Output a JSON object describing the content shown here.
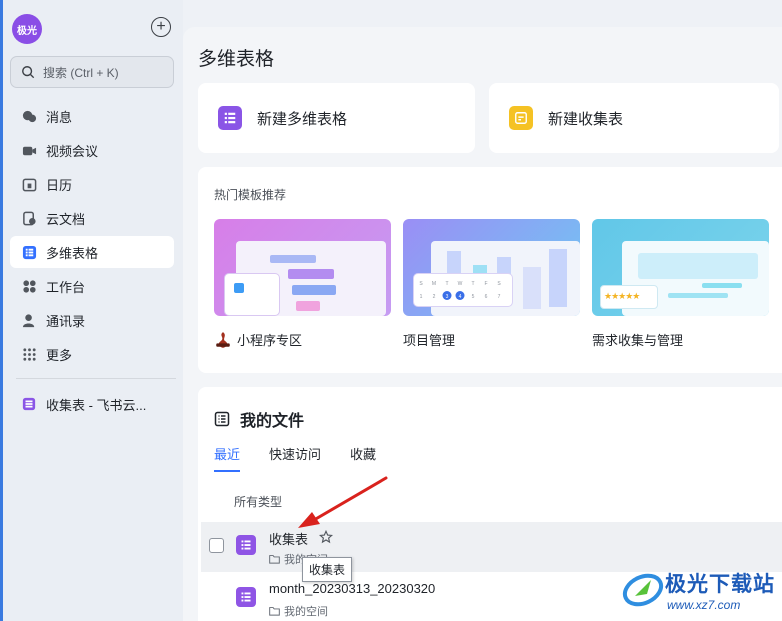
{
  "sidebar": {
    "avatar_text": "极光",
    "add_symbol": "+",
    "search_placeholder": "搜索 (Ctrl + K)",
    "items": [
      {
        "label": "消息",
        "icon": "chat-bubble-icon"
      },
      {
        "label": "视频会议",
        "icon": "video-camera-icon"
      },
      {
        "label": "日历",
        "icon": "calendar-icon"
      },
      {
        "label": "云文档",
        "icon": "cloud-doc-icon"
      },
      {
        "label": "多维表格",
        "icon": "base-table-icon",
        "active": true
      },
      {
        "label": "工作台",
        "icon": "workplace-grid-icon"
      },
      {
        "label": "通讯录",
        "icon": "contacts-icon"
      },
      {
        "label": "更多",
        "icon": "more-dots-icon"
      }
    ],
    "recent_doc": "收集表 - 飞书云..."
  },
  "main": {
    "title": "多维表格",
    "create": [
      {
        "label": "新建多维表格",
        "icon": "base-table-icon",
        "color": "#8a55e6"
      },
      {
        "label": "新建收集表",
        "icon": "form-icon",
        "color": "#f5c224"
      }
    ],
    "templates": {
      "heading": "热门模板推荐",
      "items": [
        {
          "label": "小程序专区",
          "icon": "miniapp-icon"
        },
        {
          "label": "项目管理"
        },
        {
          "label": "需求收集与管理"
        }
      ],
      "calendar_glyphs": [
        "S",
        "M",
        "T",
        "W",
        "T",
        "F",
        "S",
        "1",
        "2",
        "3",
        "4",
        "5",
        "6",
        "7"
      ]
    },
    "files": {
      "title": "我的文件",
      "tabs": [
        "最近",
        "快速访问",
        "收藏"
      ],
      "active_tab": "最近",
      "filter": "所有类型",
      "rows": [
        {
          "name": "收集表",
          "location": "我的空间"
        },
        {
          "name": "month_20230313_20230320",
          "location": "我的空间"
        }
      ],
      "tooltip": "收集表"
    }
  },
  "watermark": {
    "title": "极光下载站",
    "url": "www.xz7.com"
  },
  "colors": {
    "accent": "#3370ff",
    "base_purple": "#8a55e6",
    "form_yellow": "#f5c224",
    "annotation_red": "#d9221d"
  }
}
